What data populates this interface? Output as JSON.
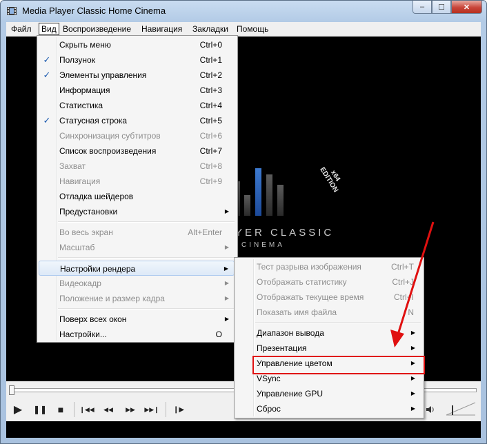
{
  "window": {
    "title": "Media Player Classic Home Cinema"
  },
  "caption_buttons": {
    "minimize": "–",
    "maximize": "☐",
    "close": "✕"
  },
  "menubar": [
    {
      "label": "Файл",
      "open": false
    },
    {
      "label": "Вид",
      "open": true
    },
    {
      "label": "Воспроизведение",
      "open": false
    },
    {
      "label": "Навигация",
      "open": false
    },
    {
      "label": "Закладки",
      "open": false
    },
    {
      "label": "Помощь",
      "open": false
    }
  ],
  "logo": {
    "main": "YER CLASSIC",
    "sub": "CINEMA",
    "edition_line1": "x64",
    "edition_line2": "EDITION"
  },
  "view_menu": [
    {
      "label": "Скрыть меню",
      "shortcut": "Ctrl+0",
      "checked": false,
      "disabled": false,
      "submenu": false
    },
    {
      "label": "Ползунок",
      "shortcut": "Ctrl+1",
      "checked": true,
      "disabled": false,
      "submenu": false
    },
    {
      "label": "Элементы управления",
      "shortcut": "Ctrl+2",
      "checked": true,
      "disabled": false,
      "submenu": false
    },
    {
      "label": "Информация",
      "shortcut": "Ctrl+3",
      "checked": false,
      "disabled": false,
      "submenu": false
    },
    {
      "label": "Статистика",
      "shortcut": "Ctrl+4",
      "checked": false,
      "disabled": false,
      "submenu": false
    },
    {
      "label": "Статусная строка",
      "shortcut": "Ctrl+5",
      "checked": true,
      "disabled": false,
      "submenu": false
    },
    {
      "label": "Синхронизация субтитров",
      "shortcut": "Ctrl+6",
      "checked": false,
      "disabled": true,
      "submenu": false
    },
    {
      "label": "Список воспроизведения",
      "shortcut": "Ctrl+7",
      "checked": false,
      "disabled": false,
      "submenu": false
    },
    {
      "label": "Захват",
      "shortcut": "Ctrl+8",
      "checked": false,
      "disabled": true,
      "submenu": false
    },
    {
      "label": "Навигация",
      "shortcut": "Ctrl+9",
      "checked": false,
      "disabled": true,
      "submenu": false
    },
    {
      "label": "Отладка шейдеров",
      "shortcut": "",
      "checked": false,
      "disabled": false,
      "submenu": false
    },
    {
      "label": "Предустановки",
      "shortcut": "",
      "checked": false,
      "disabled": false,
      "submenu": true
    },
    {
      "separator": true
    },
    {
      "label": "Во весь экран",
      "shortcut": "Alt+Enter",
      "checked": false,
      "disabled": true,
      "submenu": false
    },
    {
      "label": "Масштаб",
      "shortcut": "",
      "checked": false,
      "disabled": true,
      "submenu": true
    },
    {
      "separator": true
    },
    {
      "label": "Настройки рендера",
      "shortcut": "",
      "checked": false,
      "disabled": false,
      "submenu": true,
      "highlighted": true
    },
    {
      "label": "Видеокадр",
      "shortcut": "",
      "checked": false,
      "disabled": true,
      "submenu": true
    },
    {
      "label": "Положение и размер кадра",
      "shortcut": "",
      "checked": false,
      "disabled": true,
      "submenu": true
    },
    {
      "separator": true
    },
    {
      "label": "Поверх всех окон",
      "shortcut": "",
      "checked": false,
      "disabled": false,
      "submenu": true
    },
    {
      "label": "Настройки...",
      "shortcut": "O",
      "checked": false,
      "disabled": false,
      "submenu": false
    }
  ],
  "render_menu": [
    {
      "label": "Тест разрыва изображения",
      "shortcut": "Ctrl+T",
      "disabled": true,
      "submenu": false
    },
    {
      "label": "Отображать статистику",
      "shortcut": "Ctrl+J",
      "disabled": true,
      "submenu": false
    },
    {
      "label": "Отображать текущее время",
      "shortcut": "Ctrl+I",
      "disabled": true,
      "submenu": false
    },
    {
      "label": "Показать имя файла",
      "shortcut": "N",
      "disabled": true,
      "submenu": false
    },
    {
      "separator": true
    },
    {
      "label": "Диапазон вывода",
      "shortcut": "",
      "disabled": false,
      "submenu": true
    },
    {
      "label": "Презентация",
      "shortcut": "",
      "disabled": false,
      "submenu": true
    },
    {
      "label": "Управление цветом",
      "shortcut": "",
      "disabled": false,
      "submenu": true,
      "annotated": true
    },
    {
      "label": "VSync",
      "shortcut": "",
      "disabled": false,
      "submenu": true
    },
    {
      "label": "Управление GPU",
      "shortcut": "",
      "disabled": false,
      "submenu": true
    },
    {
      "label": "Сброс",
      "shortcut": "",
      "disabled": false,
      "submenu": true
    }
  ],
  "controls": [
    {
      "name": "play-button",
      "glyph": "▶"
    },
    {
      "name": "pause-button",
      "glyph": "❚❚"
    },
    {
      "name": "stop-button",
      "glyph": "■"
    },
    {
      "name": "previous-button",
      "glyph": "❙◀◀"
    },
    {
      "name": "rewind-button",
      "glyph": "◀◀"
    },
    {
      "name": "forward-button",
      "glyph": "▶▶"
    },
    {
      "name": "next-button",
      "glyph": "▶▶❙"
    },
    {
      "name": "frame-step-button",
      "glyph": "❙▶"
    }
  ],
  "colors": {
    "highlight_border": "#aecbef",
    "annotation_red": "#e01010",
    "check_blue": "#1e5cb0"
  }
}
